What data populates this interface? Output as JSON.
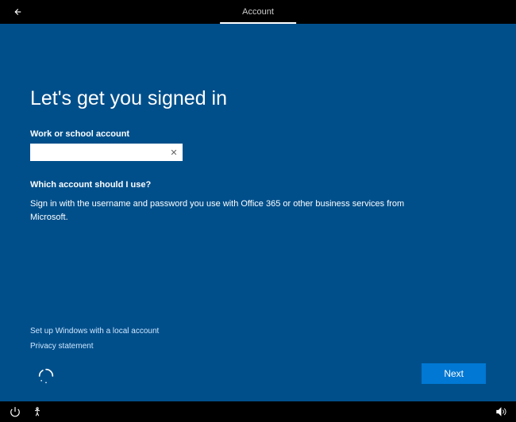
{
  "header": {
    "tab": "Account"
  },
  "main": {
    "title": "Let's get you signed in",
    "account_label": "Work or school account",
    "input_value": "",
    "subhead": "Which account should I use?",
    "body": "Sign in with the username and password you use with Office 365 or other business services from Microsoft."
  },
  "links": {
    "local_account": "Set up Windows with a local account",
    "privacy": "Privacy statement"
  },
  "buttons": {
    "next": "Next"
  }
}
